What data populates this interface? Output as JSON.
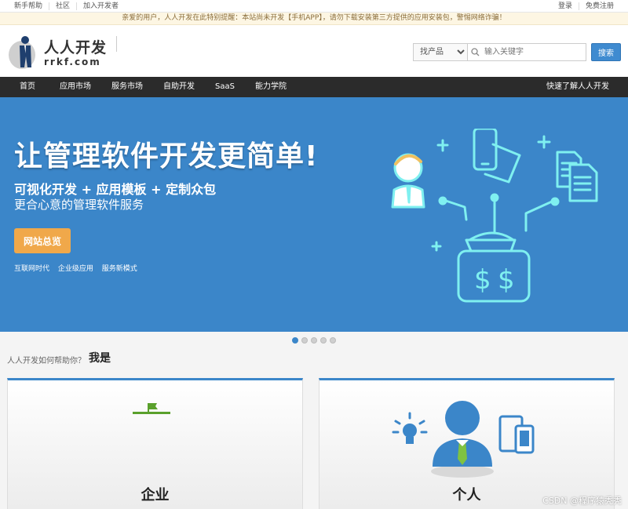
{
  "topbar": {
    "left_links": [
      "新手帮助",
      "社区",
      "加入开发者"
    ],
    "right_links": [
      "登录",
      "免费注册"
    ]
  },
  "notice": "亲爱的用户，人人开发在此特别提醒：本站尚未开发【手机APP】，请勿下载安装第三方提供的应用安装包，警惕网络诈骗！",
  "logo": {
    "name_cn": "人人开发",
    "name_en": "rrkf.com"
  },
  "search": {
    "category": "找产品",
    "placeholder": "输入关键字",
    "button": "搜索"
  },
  "nav": {
    "items": [
      "首页",
      "应用市场",
      "服务市场",
      "自助开发",
      "SaaS",
      "能力学院"
    ],
    "right": "快速了解人人开发"
  },
  "banner": {
    "headline": "让管理软件开发更简单!",
    "subhead": "可视化开发 + 应用模板 + 定制众包",
    "tagline": "更合心意的管理软件服务",
    "cta": "网站总览",
    "tags": [
      "互联网时代",
      "企业级应用",
      "服务新模式"
    ],
    "colors": {
      "background": "#3b86c9",
      "cta": "#f0a84a",
      "art": "#7ff0f0"
    }
  },
  "carousel": {
    "count": 5,
    "active": 1
  },
  "help": {
    "question": "人人开发如何帮助你？",
    "emphasis": "我是"
  },
  "cards": [
    {
      "title": "企业",
      "icon": "flag-icon"
    },
    {
      "title": "个人",
      "icon": "person-icon"
    }
  ],
  "watermark": "CSDN @程序猿秃秃"
}
